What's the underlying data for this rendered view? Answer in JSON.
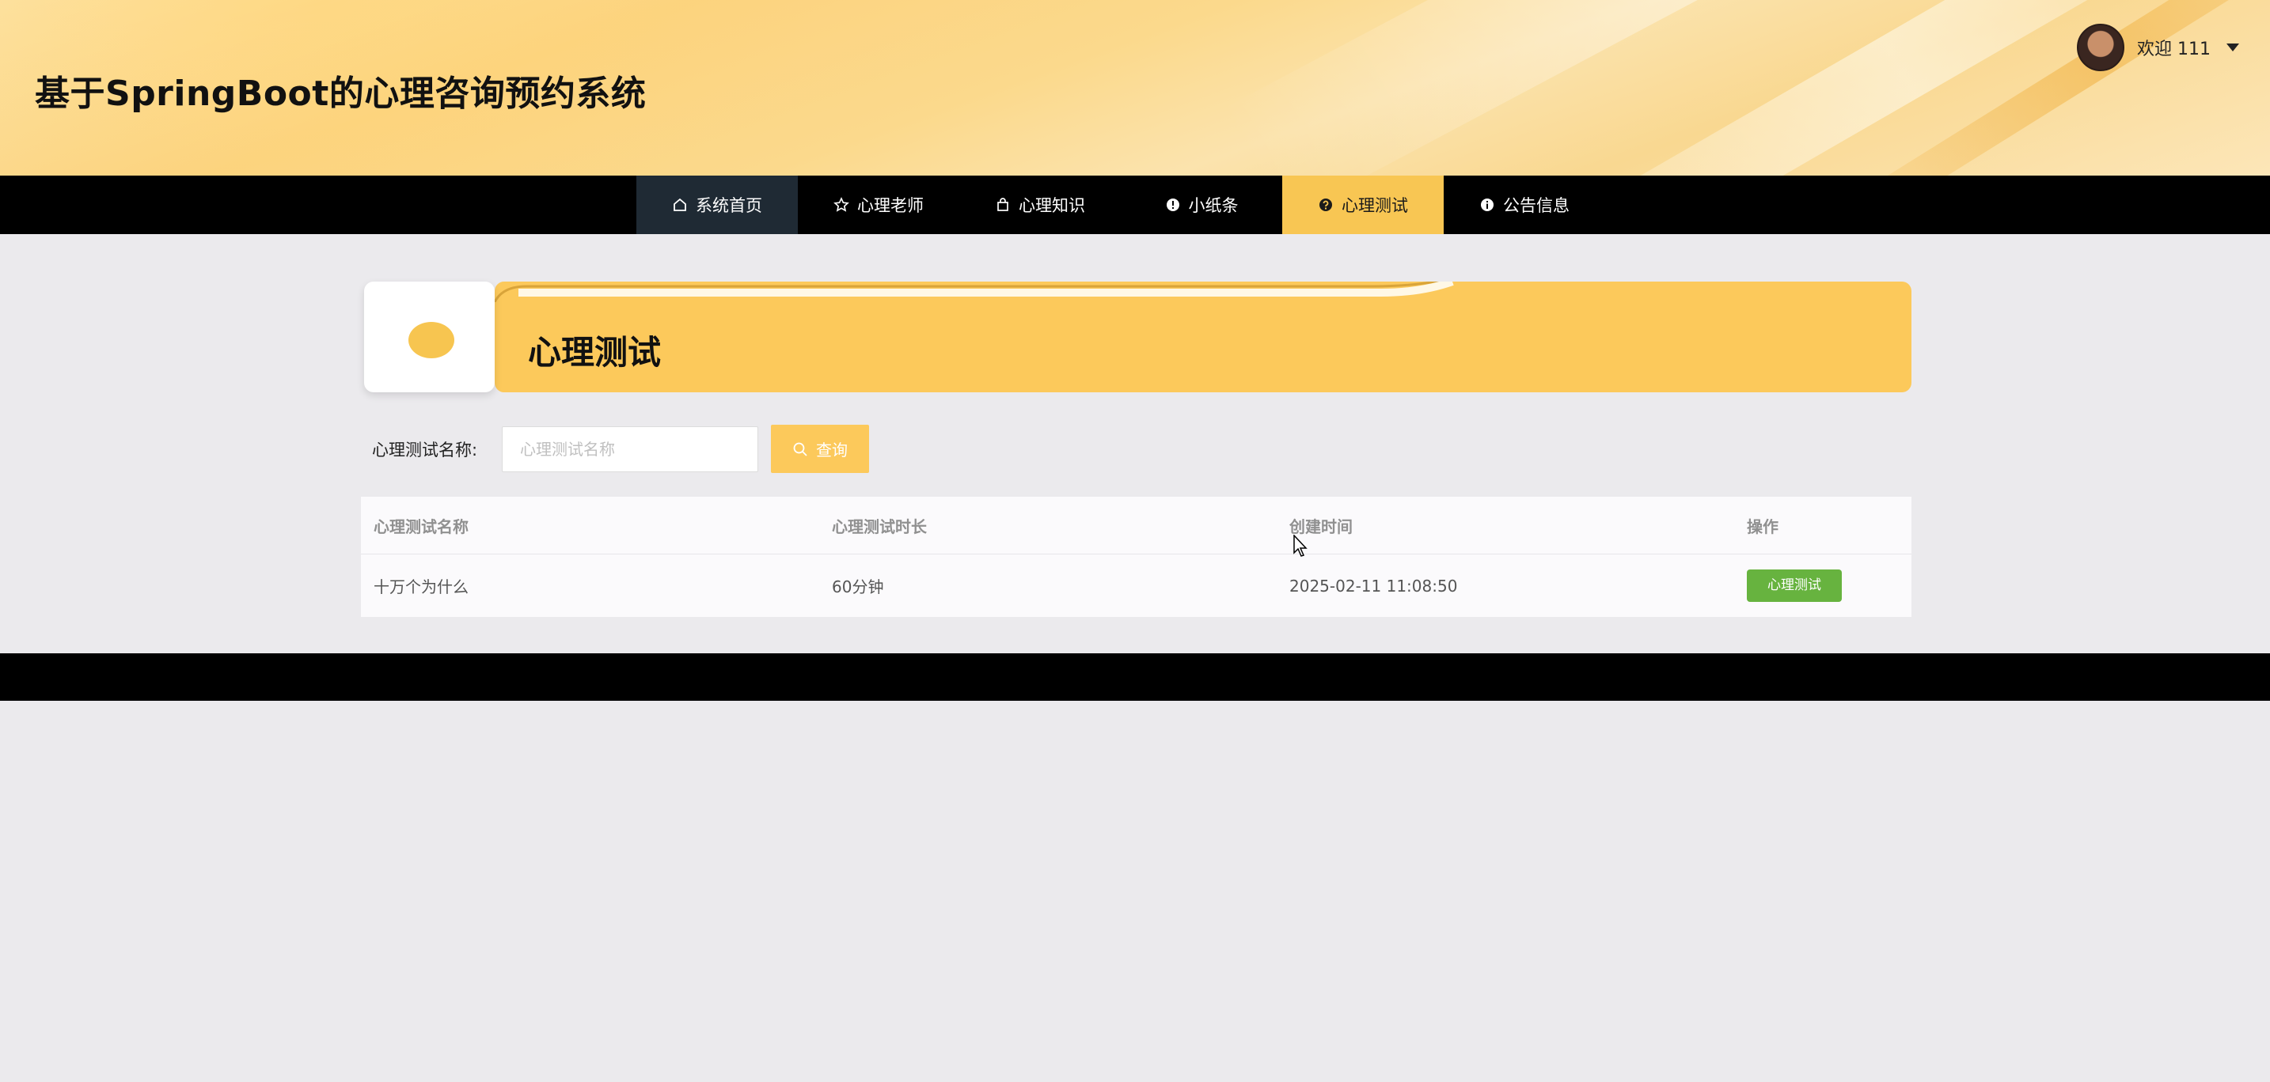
{
  "header": {
    "site_title": "基于SpringBoot的心理咨询预约系统",
    "welcome_text": "欢迎 111"
  },
  "nav": {
    "items": [
      {
        "label": "系统首页",
        "icon": "home-icon"
      },
      {
        "label": "心理老师",
        "icon": "star-icon"
      },
      {
        "label": "心理知识",
        "icon": "bag-icon"
      },
      {
        "label": "小纸条",
        "icon": "exclamation-circle-icon"
      },
      {
        "label": "心理测试",
        "icon": "question-circle-icon"
      },
      {
        "label": "公告信息",
        "icon": "info-circle-icon"
      }
    ],
    "active_index": 4
  },
  "banner": {
    "title": "心理测试"
  },
  "search": {
    "label": "心理测试名称:",
    "placeholder": "心理测试名称",
    "value": "",
    "button_label": "查询"
  },
  "table": {
    "columns": [
      "心理测试名称",
      "心理测试时长",
      "创建时间",
      "操作"
    ],
    "rows": [
      {
        "name": "十万个为什么",
        "duration": "60分钟",
        "created": "2025-02-11 11:08:50",
        "action": "心理测试"
      }
    ]
  },
  "colors": {
    "accent": "#f8c653",
    "nav_bg": "#000000",
    "nav_home_bg": "#1f2a34",
    "action_green": "#67b33f",
    "page_bg": "#ebeaed"
  }
}
